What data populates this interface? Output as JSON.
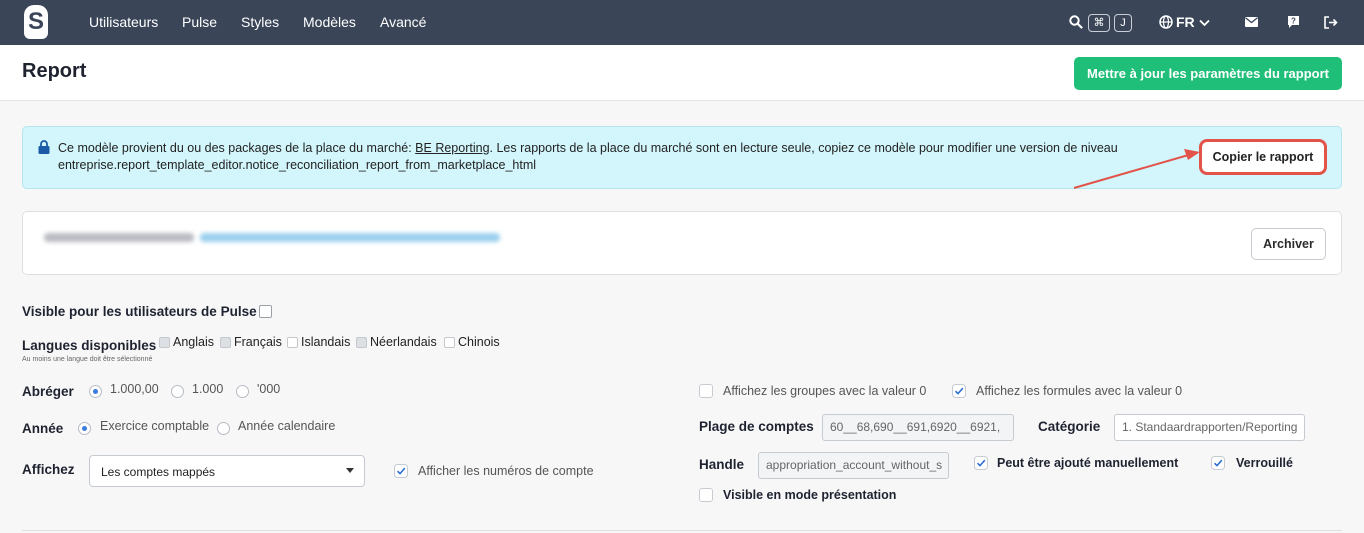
{
  "nav": {
    "logo_letter": "S",
    "links": [
      "Utilisateurs",
      "Pulse",
      "Styles",
      "Modèles",
      "Avancé"
    ],
    "kbd_cmd": "⌘",
    "kbd_key": "J",
    "language": "FR",
    "icons": [
      "search-icon",
      "globe-icon",
      "chevron-down-icon",
      "mail-icon",
      "help-chat-icon",
      "logout-icon"
    ]
  },
  "header": {
    "title": "Report",
    "update_button": "Mettre à jour les paramètres du rapport"
  },
  "notice": {
    "text_before": "Ce modèle provient du ou des packages de la place du marché: ",
    "package_link": "BE Reporting",
    "text_after": ". Les rapports de la place du marché sont en lecture seule, copiez ce modèle pour modifier une version de niveau entreprise.report_template_editor.notice_reconciliation_report_from_marketplace_html",
    "copy_button": "Copier le rapport"
  },
  "archive_panel": {
    "archive_button": "Archiver"
  },
  "form": {
    "visible_pulse_label": "Visible pour les utilisateurs de Pulse",
    "visible_pulse_checked": false,
    "languages_label": "Langues disponibles",
    "languages_hint": "Au moins une langue doit être sélectionné",
    "languages": [
      {
        "name": "Anglais",
        "checked": true
      },
      {
        "name": "Français",
        "checked": true
      },
      {
        "name": "Islandais",
        "checked": false
      },
      {
        "name": "Néerlandais",
        "checked": true
      },
      {
        "name": "Chinois",
        "checked": false
      }
    ],
    "abbreviate_label": "Abréger",
    "abbreviate_options": [
      "1.000,00",
      "1.000",
      "'000"
    ],
    "abbreviate_selected": "1.000,00",
    "year_label": "Année",
    "year_options": [
      "Exercice comptable",
      "Année calendaire"
    ],
    "year_selected": "Exercice comptable",
    "show_label": "Affichez",
    "show_select_value": "Les comptes mappés",
    "show_account_numbers_label": "Afficher les numéros de compte",
    "show_account_numbers_checked": true,
    "show_zero_groups_label": "Affichez les groupes avec la valeur 0",
    "show_zero_groups_checked": false,
    "show_zero_formulas_label": "Affichez les formules avec la valeur 0",
    "show_zero_formulas_checked": true,
    "account_range_label": "Plage de comptes",
    "account_range_value": "60__68,690__691,6920__6921,",
    "category_label": "Catégorie",
    "category_value": "1. Standaardrapporten/Reporting",
    "handle_label": "Handle",
    "handle_value": "appropriation_account_without_s",
    "manual_add_label": "Peut être ajouté manuellement",
    "manual_add_checked": true,
    "locked_label": "Verrouillé",
    "locked_checked": true,
    "presentation_label": "Visible en mode présentation",
    "presentation_checked": false
  }
}
